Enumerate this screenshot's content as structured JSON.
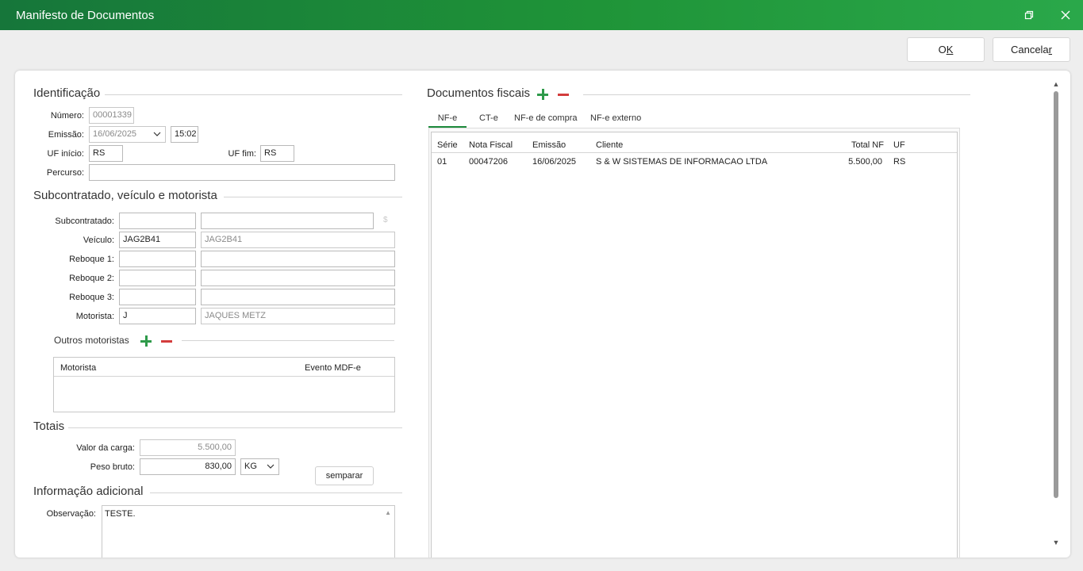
{
  "window": {
    "title": "Manifesto de Documentos"
  },
  "actions": {
    "ok_label": "OK",
    "ok_prefix": "O",
    "ok_underlined": "K",
    "cancel_prefix": "Cancela",
    "cancel_underlined": "r"
  },
  "identificacao": {
    "title": "Identificação",
    "numero_label": "Número:",
    "numero_value": "00001339",
    "emissao_label": "Emissão:",
    "emissao_date": "16/06/2025",
    "emissao_time": "15:02",
    "uf_inicio_label": "UF início:",
    "uf_inicio_value": "RS",
    "uf_fim_label": "UF fim:",
    "uf_fim_value": "RS",
    "percurso_label": "Percurso:",
    "percurso_value": ""
  },
  "subcontratado": {
    "title": "Subcontratado, veículo e motorista",
    "subcontratado_label": "Subcontratado:",
    "subcontratado_code": "",
    "subcontratado_name": "",
    "subcontratado_symbol": "$",
    "veiculo_label": "Veículo:",
    "veiculo_code": "JAG2B41",
    "veiculo_name": "JAG2B41",
    "reboque1_label": "Reboque 1:",
    "reboque1_code": "",
    "reboque1_name": "",
    "reboque2_label": "Reboque 2:",
    "reboque2_code": "",
    "reboque2_name": "",
    "reboque3_label": "Reboque 3:",
    "reboque3_code": "",
    "reboque3_name": "",
    "motorista_label": "Motorista:",
    "motorista_code": "J",
    "motorista_name": "JAQUES METZ",
    "outros_title": "Outros motoristas",
    "outros_columns": [
      "Motorista",
      "Evento MDF-e"
    ]
  },
  "totais": {
    "title": "Totais",
    "valor_label": "Valor da carga:",
    "valor_value": "5.500,00",
    "peso_label": "Peso bruto:",
    "peso_value": "830,00",
    "peso_unit": "KG",
    "semparar_label": "semparar"
  },
  "info_adicional": {
    "title": "Informação adicional",
    "observacao_label": "Observação:",
    "observacao_value": "TESTE."
  },
  "documentos": {
    "title": "Documentos fiscais",
    "tabs": [
      "NF-e",
      "CT-e",
      "NF-e de compra",
      "NF-e externo"
    ],
    "active_tab": 0,
    "columns": [
      "Série",
      "Nota Fiscal",
      "Emissão",
      "Cliente",
      "Total NF",
      "UF"
    ],
    "rows": [
      {
        "serie": "01",
        "nota": "00047206",
        "emissao": "16/06/2025",
        "cliente": "S & W SISTEMAS DE INFORMACAO LTDA",
        "total": "5.500,00",
        "uf": "RS"
      }
    ]
  },
  "colors": {
    "title_bar_start": "#16763a",
    "title_bar_end": "#2aa84a",
    "add": "#2e9a4a",
    "remove": "#d33c3c",
    "tab_accent": "#1d8a3c"
  }
}
